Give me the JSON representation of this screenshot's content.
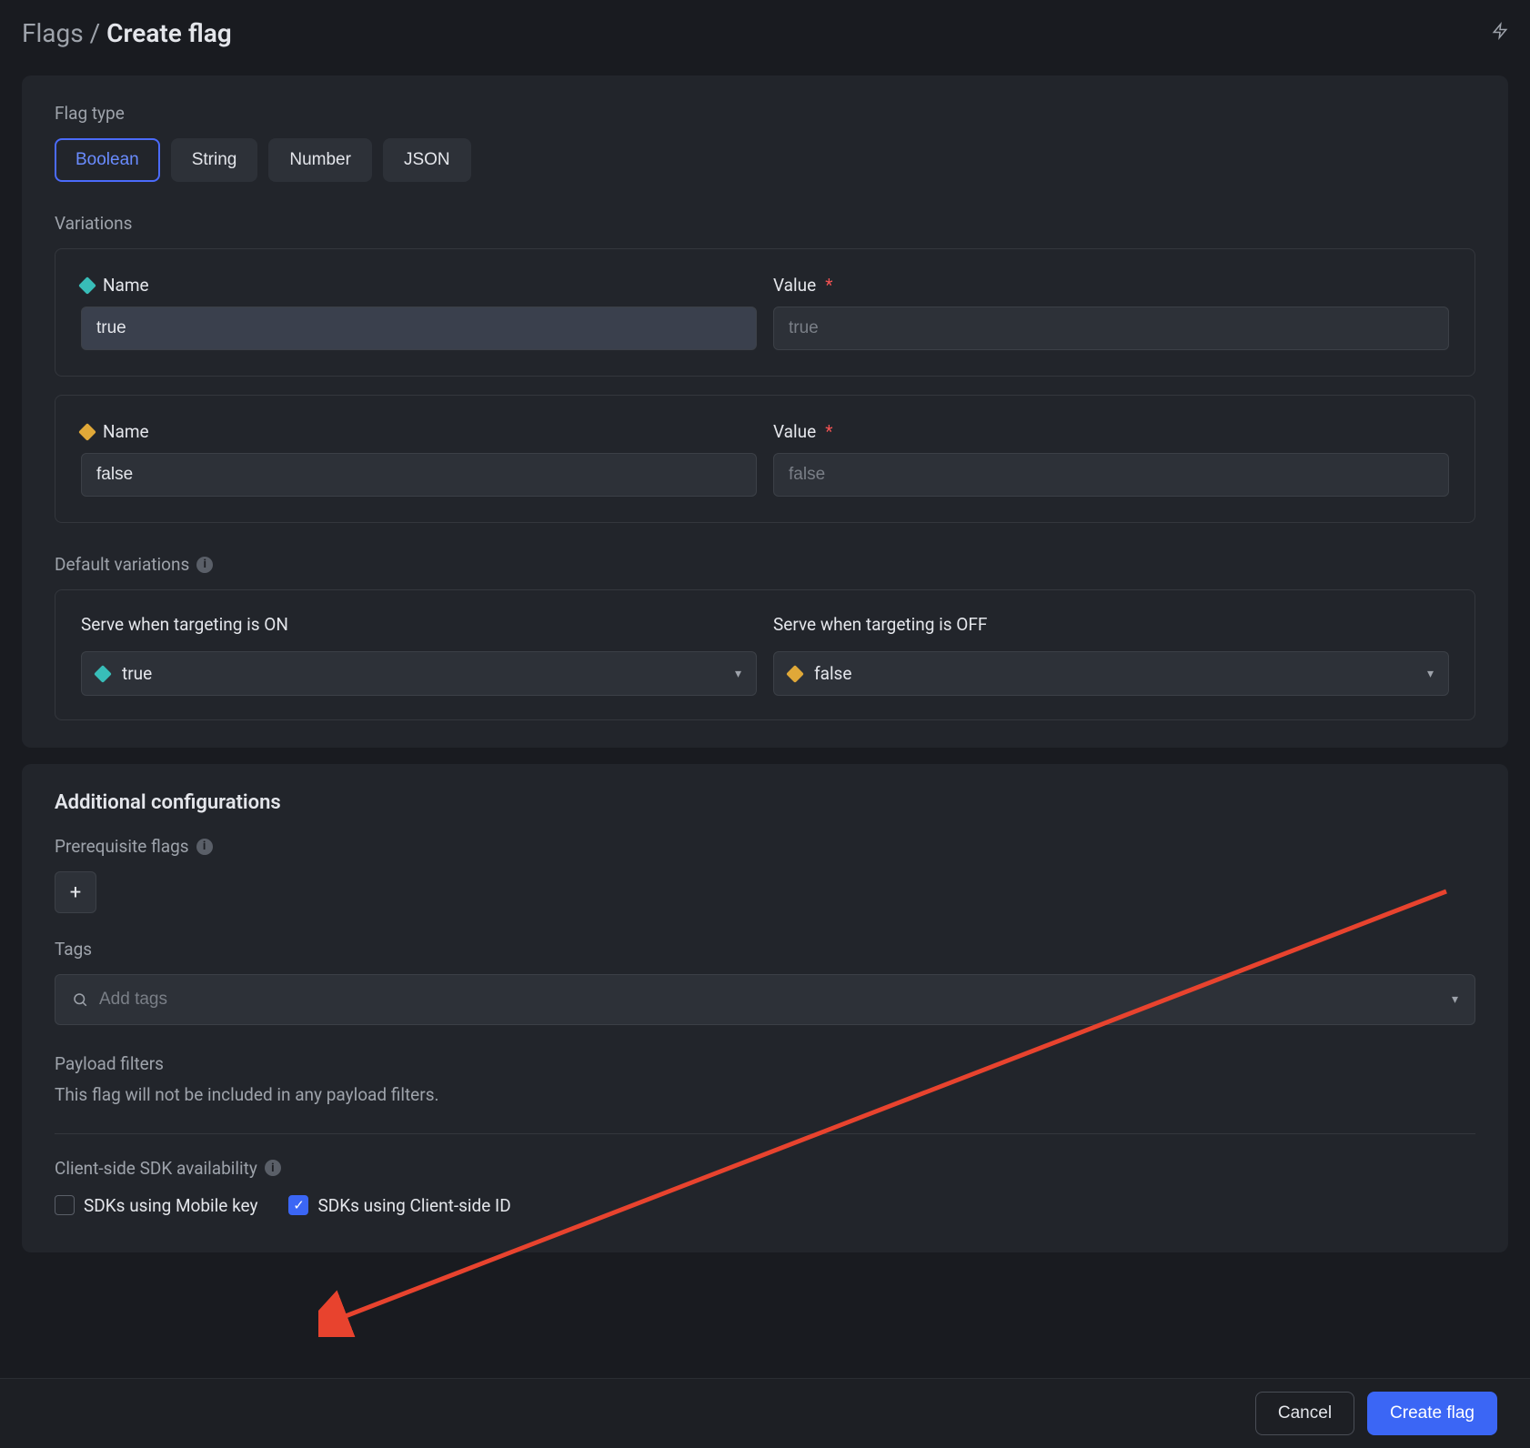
{
  "breadcrumb": {
    "parent": "Flags",
    "separator": "/",
    "current": "Create flag"
  },
  "flag_type": {
    "label": "Flag type",
    "options": [
      "Boolean",
      "String",
      "Number",
      "JSON"
    ],
    "selected": "Boolean"
  },
  "variations": {
    "label": "Variations",
    "items": [
      {
        "name_label": "Name",
        "value_label": "Value",
        "name_value": "true",
        "value_placeholder": "true",
        "color": "teal"
      },
      {
        "name_label": "Name",
        "value_label": "Value",
        "name_value": "false",
        "value_placeholder": "false",
        "color": "amber"
      }
    ]
  },
  "default_variations": {
    "label": "Default variations",
    "serve_on": {
      "label": "Serve when targeting is ON",
      "value": "true",
      "color": "teal"
    },
    "serve_off": {
      "label": "Serve when targeting is OFF",
      "value": "false",
      "color": "amber"
    }
  },
  "additional": {
    "title": "Additional configurations",
    "prerequisite_label": "Prerequisite flags",
    "tags_label": "Tags",
    "tags_placeholder": "Add tags",
    "payload_label": "Payload filters",
    "payload_text": "This flag will not be included in any payload filters.",
    "sdk_label": "Client-side SDK availability",
    "sdk_mobile": "SDKs using Mobile key",
    "sdk_client": "SDKs using Client-side ID"
  },
  "footer": {
    "cancel": "Cancel",
    "create": "Create flag"
  }
}
